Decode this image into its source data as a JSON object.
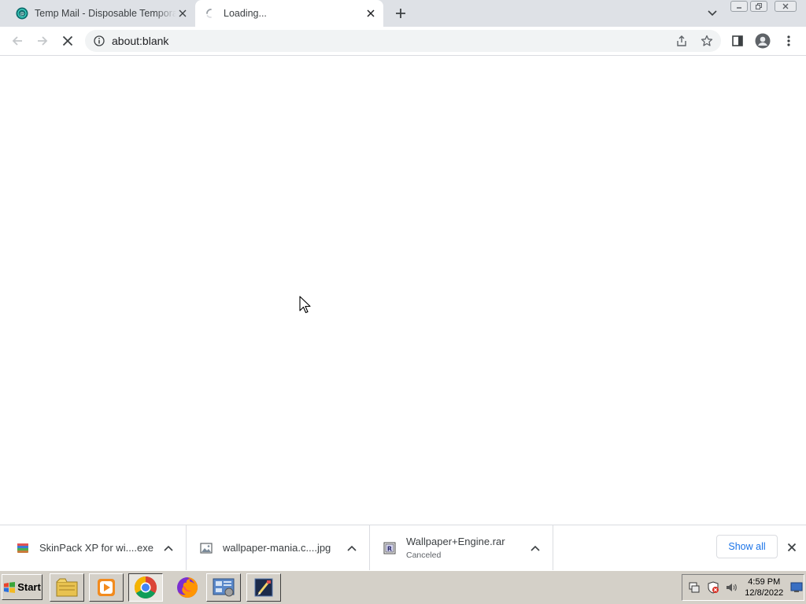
{
  "tabs": [
    {
      "title": "Temp Mail - Disposable Temporary Email",
      "favicon": "tempmail-icon",
      "active": false
    },
    {
      "title": "Loading...",
      "favicon": "loading-spinner-icon",
      "active": true
    }
  ],
  "toolbar": {
    "url": "about:blank",
    "back_icon": "back-arrow-icon",
    "forward_icon": "forward-arrow-icon",
    "stop_icon": "stop-icon"
  },
  "downloads": [
    {
      "name": "SkinPack XP for wi....exe",
      "status": "",
      "icon": "installer-icon"
    },
    {
      "name": "wallpaper-mania.c....jpg",
      "status": "",
      "icon": "image-file-icon"
    },
    {
      "name": "Wallpaper+Engine.rar",
      "status": "Canceled",
      "icon": "rar-archive-icon"
    }
  ],
  "download_shelf": {
    "show_all_label": "Show all"
  },
  "taskbar": {
    "start_label": "Start",
    "apps": [
      "file-explorer-icon",
      "media-player-icon",
      "chrome-icon",
      "firefox-icon",
      "control-panel-icon",
      "paint-icon"
    ],
    "clock_time": "4:59 PM",
    "clock_date": "12/8/2022"
  },
  "colors": {
    "accent": "#1a73e8",
    "tabstrip": "#dee1e6",
    "taskbar": "#d4d0c8"
  }
}
